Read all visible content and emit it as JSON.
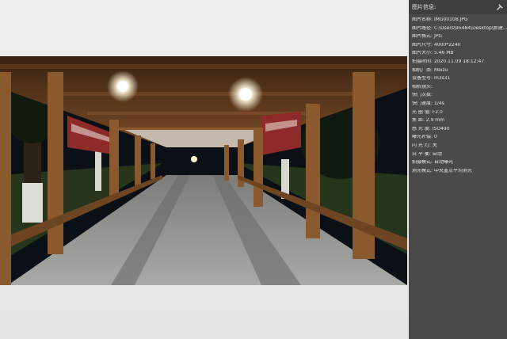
{
  "panel": {
    "title": "图片信息:",
    "pin_icon": "pin-icon",
    "rows": [
      {
        "label": "图片名称:",
        "value": "IMG00108.JPG"
      },
      {
        "label": "图片路径:",
        "value": "C:\\Users\\95484\\Desktop\\新建..."
      },
      {
        "label": "图片格式:",
        "value": "JPG"
      },
      {
        "label": "图片尺寸:",
        "value": "4000*2240"
      },
      {
        "label": "图片大小:",
        "value": "5.46 MB"
      },
      {
        "label": "拍摄时间:",
        "value": "2020.11.09 18:12:47"
      },
      {
        "label": "相机厂商:",
        "value": "Meizu"
      },
      {
        "label": "设备型号:",
        "value": "m3s31"
      },
      {
        "label": "相机镜头:",
        "value": ""
      },
      {
        "label": "快门次数:",
        "value": ""
      },
      {
        "label": "快门速度:",
        "value": "1/4s"
      },
      {
        "label": "光 圈 值:",
        "value": "F2.0"
      },
      {
        "label": "焦    距:",
        "value": "2.9 mm"
      },
      {
        "label": "感 光 度:",
        "value": "ISO490"
      },
      {
        "label": "曝光补偿:",
        "value": "0"
      },
      {
        "label": "闪 光 灯:",
        "value": "关"
      },
      {
        "label": "白 平 衡:",
        "value": "自动"
      },
      {
        "label": "拍摄模式:",
        "value": "自动曝光"
      },
      {
        "label": "测光模式:",
        "value": "中央重点平均测光"
      }
    ]
  },
  "photo": {
    "subject": "covered walkway at night",
    "colors": {
      "wood": "#8a5a2e",
      "sky": "#0a1016",
      "floor": "#8a8a86",
      "lamp": "#ffffff"
    }
  }
}
